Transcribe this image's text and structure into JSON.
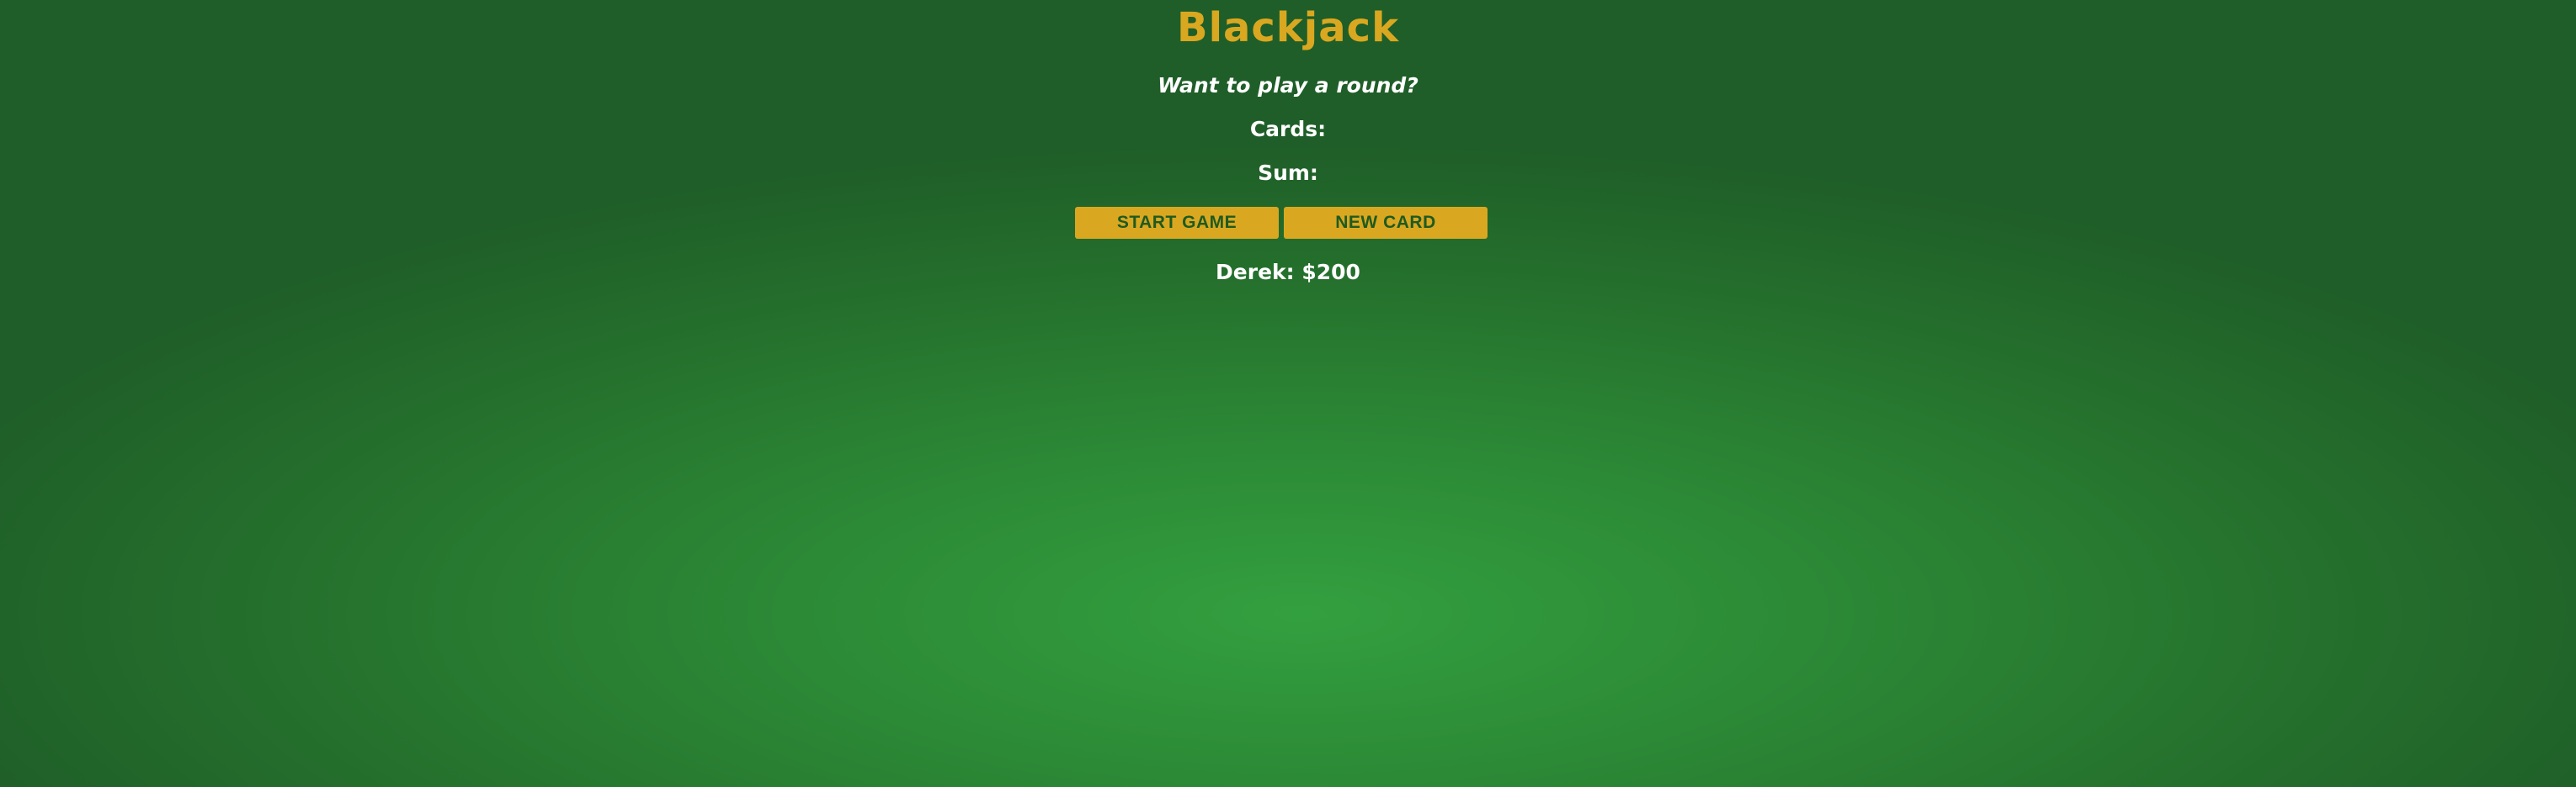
{
  "game": {
    "title": "Blackjack",
    "message": "Want to play a round?",
    "cards_label": "Cards:",
    "sum_label": "Sum:",
    "buttons": {
      "start_game": "START GAME",
      "new_card": "NEW CARD"
    },
    "player": {
      "name_and_chips": "Derek: $200"
    }
  },
  "colors": {
    "accent": "#d9a820",
    "table_green_center": "#33a03f",
    "table_green_edge": "#1f5e28",
    "button_text": "#1f5a20",
    "text": "#ffffff"
  }
}
